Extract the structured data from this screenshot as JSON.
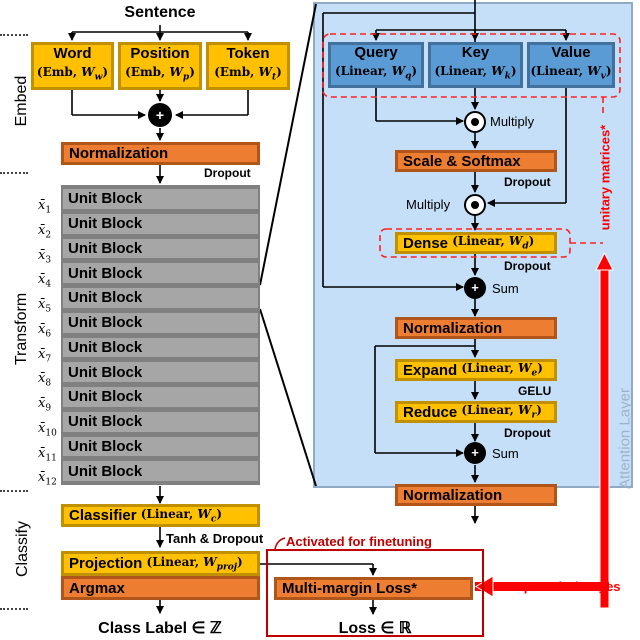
{
  "title": "Sentence",
  "sections": {
    "embed": "Embed",
    "transform": "Transform",
    "classify": "Classify"
  },
  "embed": {
    "word": {
      "name": "Word",
      "op": "Emb",
      "weight": "W",
      "sub": "w"
    },
    "position": {
      "name": "Position",
      "op": "Emb",
      "weight": "W",
      "sub": "p"
    },
    "token": {
      "name": "Token",
      "op": "Emb",
      "weight": "W",
      "sub": "t"
    },
    "norm": "Normalization",
    "dropout": "Dropout"
  },
  "transform": {
    "unit_blocks": [
      "Unit Block",
      "Unit Block",
      "Unit Block",
      "Unit Block",
      "Unit Block",
      "Unit Block",
      "Unit Block",
      "Unit Block",
      "Unit Block",
      "Unit Block",
      "Unit Block",
      "Unit Block"
    ],
    "hidden_states": [
      "1",
      "2",
      "3",
      "4",
      "5",
      "6",
      "7",
      "8",
      "9",
      "10",
      "11",
      "12"
    ],
    "hidden_symbol": "x̄"
  },
  "classify": {
    "classifier": {
      "name": "Classifier",
      "op": "Linear",
      "weight": "W",
      "sub": "c"
    },
    "tanh_dropout": "Tanh & Dropout",
    "projection": {
      "name": "Projection",
      "op": "Linear",
      "weight": "W",
      "sub": "proj"
    },
    "argmax": "Argmax",
    "output": "Class Label ∈ ℤ"
  },
  "finetune": {
    "title": "Activated for finetuning",
    "loss_box": "Multi-margin Loss*",
    "output": "Loss ∈ ℝ"
  },
  "attention": {
    "layer_label": "Attention Layer",
    "query": {
      "name": "Query",
      "op": "Linear",
      "weight": "W",
      "sub": "q"
    },
    "key": {
      "name": "Key",
      "op": "Linear",
      "weight": "W",
      "sub": "k"
    },
    "value": {
      "name": "Value",
      "op": "Linear",
      "weight": "W",
      "sub": "v"
    },
    "multiply1": "Multiply",
    "scale_softmax": "Scale & Softmax",
    "dropout1": "Dropout",
    "multiply2": "Multiply",
    "dense": {
      "name": "Dense",
      "op": "Linear",
      "weight": "W",
      "sub": "d"
    },
    "dropout2": "Dropout",
    "sum1": "Sum",
    "norm1": "Normalization",
    "expand": {
      "name": "Expand",
      "op": "Linear",
      "weight": "W",
      "sub": "e"
    },
    "gelu": "GELU",
    "reduce": {
      "name": "Reduce",
      "op": "Linear",
      "weight": "W",
      "sub": "r"
    },
    "dropout3": "Dropout",
    "sum2": "Sum",
    "norm2": "Normalization"
  },
  "annotations": {
    "unitary": "unitary matrices*",
    "proposed": "*Proposed Changes"
  },
  "colors": {
    "embedding_yellow": "#ffc000",
    "norm_orange": "#ed7d31",
    "unit_gray": "#a6a6a6",
    "linear_blue": "#5b9bd5",
    "attention_bg": "#c5dff8",
    "highlight_red": "#ff0000",
    "finetune_red": "#c00000"
  }
}
